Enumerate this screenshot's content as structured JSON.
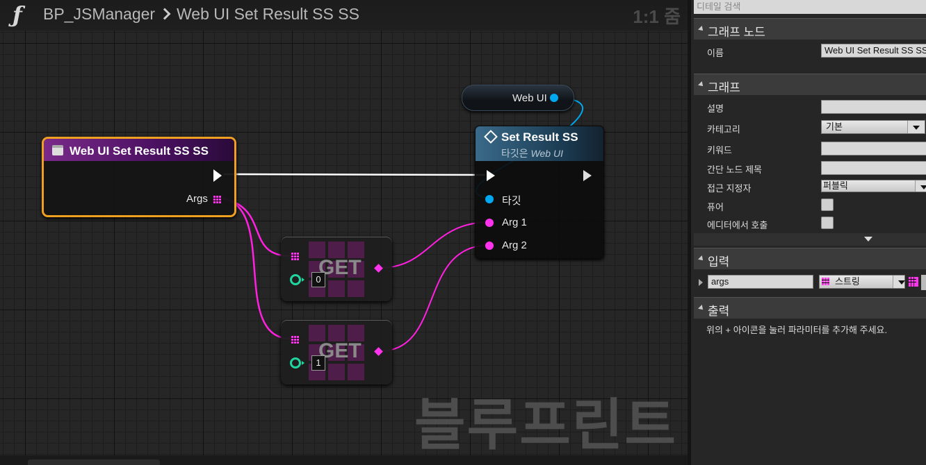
{
  "breadcrumb": {
    "root": "BP_JSManager",
    "current": "Web UI Set Result SS SS",
    "zoom": "1:1 줌"
  },
  "watermark": "블루프린트",
  "nodes": {
    "entry": {
      "title": "Web UI Set Result SS SS",
      "args_label": "Args"
    },
    "webui_var": {
      "label": "Web UI"
    },
    "set_result": {
      "title": "Set Result SS",
      "subtitle_prefix": "타깃은 ",
      "subtitle_target": "Web UI",
      "target_label": "타깃",
      "arg1_label": "Arg 1",
      "arg2_label": "Arg 2"
    },
    "get0": {
      "text": "GET",
      "index": "0"
    },
    "get1": {
      "text": "GET",
      "index": "1"
    }
  },
  "colors": {
    "exec": "#ffffff",
    "object_pin": "#00a8f0",
    "string_pin": "#ff33ee",
    "int_pin": "#1fd6a0",
    "selection": "#f0a020",
    "entry_header": "#6a1a7a"
  },
  "details": {
    "search_placeholder": "디테일 검색",
    "graph_node": {
      "header": "그래프 노드",
      "name_label": "이름",
      "name_value": "Web UI Set Result SS SS"
    },
    "graph": {
      "header": "그래프",
      "description_label": "설명",
      "category_label": "카테고리",
      "category_value": "기본",
      "keywords_label": "키워드",
      "compact_title_label": "간단 노드 제목",
      "access_label": "접근 지정자",
      "access_value": "퍼블릭",
      "pure_label": "퓨어",
      "call_in_editor_label": "에디터에서 호출"
    },
    "inputs": {
      "header": "입력",
      "param_name": "args",
      "param_type": "스트링"
    },
    "outputs": {
      "header": "출력",
      "hint": "위의 + 아이콘을 눌러 파라미터를 추가해 주세요."
    }
  }
}
